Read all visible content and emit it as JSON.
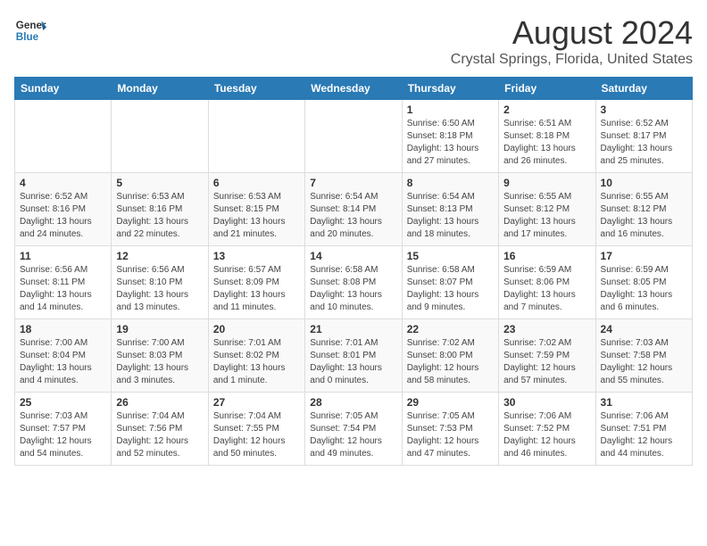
{
  "logo": {
    "line1": "General",
    "line2": "Blue"
  },
  "title": "August 2024",
  "subtitle": "Crystal Springs, Florida, United States",
  "days_of_week": [
    "Sunday",
    "Monday",
    "Tuesday",
    "Wednesday",
    "Thursday",
    "Friday",
    "Saturday"
  ],
  "weeks": [
    [
      {
        "day": "",
        "sunrise": "",
        "sunset": "",
        "daylight": ""
      },
      {
        "day": "",
        "sunrise": "",
        "sunset": "",
        "daylight": ""
      },
      {
        "day": "",
        "sunrise": "",
        "sunset": "",
        "daylight": ""
      },
      {
        "day": "",
        "sunrise": "",
        "sunset": "",
        "daylight": ""
      },
      {
        "day": "1",
        "sunrise": "6:50 AM",
        "sunset": "8:18 PM",
        "daylight": "13 hours and 27 minutes."
      },
      {
        "day": "2",
        "sunrise": "6:51 AM",
        "sunset": "8:18 PM",
        "daylight": "13 hours and 26 minutes."
      },
      {
        "day": "3",
        "sunrise": "6:52 AM",
        "sunset": "8:17 PM",
        "daylight": "13 hours and 25 minutes."
      }
    ],
    [
      {
        "day": "4",
        "sunrise": "6:52 AM",
        "sunset": "8:16 PM",
        "daylight": "13 hours and 24 minutes."
      },
      {
        "day": "5",
        "sunrise": "6:53 AM",
        "sunset": "8:16 PM",
        "daylight": "13 hours and 22 minutes."
      },
      {
        "day": "6",
        "sunrise": "6:53 AM",
        "sunset": "8:15 PM",
        "daylight": "13 hours and 21 minutes."
      },
      {
        "day": "7",
        "sunrise": "6:54 AM",
        "sunset": "8:14 PM",
        "daylight": "13 hours and 20 minutes."
      },
      {
        "day": "8",
        "sunrise": "6:54 AM",
        "sunset": "8:13 PM",
        "daylight": "13 hours and 18 minutes."
      },
      {
        "day": "9",
        "sunrise": "6:55 AM",
        "sunset": "8:12 PM",
        "daylight": "13 hours and 17 minutes."
      },
      {
        "day": "10",
        "sunrise": "6:55 AM",
        "sunset": "8:12 PM",
        "daylight": "13 hours and 16 minutes."
      }
    ],
    [
      {
        "day": "11",
        "sunrise": "6:56 AM",
        "sunset": "8:11 PM",
        "daylight": "13 hours and 14 minutes."
      },
      {
        "day": "12",
        "sunrise": "6:56 AM",
        "sunset": "8:10 PM",
        "daylight": "13 hours and 13 minutes."
      },
      {
        "day": "13",
        "sunrise": "6:57 AM",
        "sunset": "8:09 PM",
        "daylight": "13 hours and 11 minutes."
      },
      {
        "day": "14",
        "sunrise": "6:58 AM",
        "sunset": "8:08 PM",
        "daylight": "13 hours and 10 minutes."
      },
      {
        "day": "15",
        "sunrise": "6:58 AM",
        "sunset": "8:07 PM",
        "daylight": "13 hours and 9 minutes."
      },
      {
        "day": "16",
        "sunrise": "6:59 AM",
        "sunset": "8:06 PM",
        "daylight": "13 hours and 7 minutes."
      },
      {
        "day": "17",
        "sunrise": "6:59 AM",
        "sunset": "8:05 PM",
        "daylight": "13 hours and 6 minutes."
      }
    ],
    [
      {
        "day": "18",
        "sunrise": "7:00 AM",
        "sunset": "8:04 PM",
        "daylight": "13 hours and 4 minutes."
      },
      {
        "day": "19",
        "sunrise": "7:00 AM",
        "sunset": "8:03 PM",
        "daylight": "13 hours and 3 minutes."
      },
      {
        "day": "20",
        "sunrise": "7:01 AM",
        "sunset": "8:02 PM",
        "daylight": "13 hours and 1 minute."
      },
      {
        "day": "21",
        "sunrise": "7:01 AM",
        "sunset": "8:01 PM",
        "daylight": "13 hours and 0 minutes."
      },
      {
        "day": "22",
        "sunrise": "7:02 AM",
        "sunset": "8:00 PM",
        "daylight": "12 hours and 58 minutes."
      },
      {
        "day": "23",
        "sunrise": "7:02 AM",
        "sunset": "7:59 PM",
        "daylight": "12 hours and 57 minutes."
      },
      {
        "day": "24",
        "sunrise": "7:03 AM",
        "sunset": "7:58 PM",
        "daylight": "12 hours and 55 minutes."
      }
    ],
    [
      {
        "day": "25",
        "sunrise": "7:03 AM",
        "sunset": "7:57 PM",
        "daylight": "12 hours and 54 minutes."
      },
      {
        "day": "26",
        "sunrise": "7:04 AM",
        "sunset": "7:56 PM",
        "daylight": "12 hours and 52 minutes."
      },
      {
        "day": "27",
        "sunrise": "7:04 AM",
        "sunset": "7:55 PM",
        "daylight": "12 hours and 50 minutes."
      },
      {
        "day": "28",
        "sunrise": "7:05 AM",
        "sunset": "7:54 PM",
        "daylight": "12 hours and 49 minutes."
      },
      {
        "day": "29",
        "sunrise": "7:05 AM",
        "sunset": "7:53 PM",
        "daylight": "12 hours and 47 minutes."
      },
      {
        "day": "30",
        "sunrise": "7:06 AM",
        "sunset": "7:52 PM",
        "daylight": "12 hours and 46 minutes."
      },
      {
        "day": "31",
        "sunrise": "7:06 AM",
        "sunset": "7:51 PM",
        "daylight": "12 hours and 44 minutes."
      }
    ]
  ]
}
